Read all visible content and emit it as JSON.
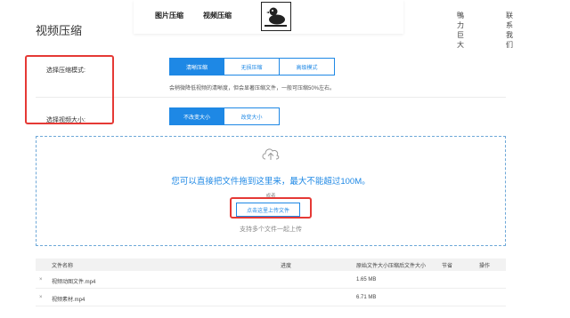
{
  "page": {
    "title": "视频压缩"
  },
  "nav": {
    "image_compress": "图片压缩",
    "video_compress": "视频压缩",
    "link_right_1": "鴨力巨大",
    "link_right_2": "联系我们"
  },
  "settings": {
    "mode": {
      "label": "选择压缩模式:",
      "options": [
        "清晰压缩",
        "无损压缩",
        "高级模式"
      ],
      "selected": "清晰压缩",
      "hint": "会稍微降低视频的清晰度，但会显著压缩文件，一般可压缩50%左右。"
    },
    "size": {
      "label": "选择视频大小:",
      "options": [
        "不改变大小",
        "改变大小"
      ],
      "selected": "不改变大小"
    }
  },
  "dropzone": {
    "message": "您可以直接把文件拖到这里来，最大不能超过100M。",
    "or": "或者",
    "upload_button": "点击这里上传文件",
    "multi": "支持多个文件一起上传"
  },
  "table": {
    "headers": {
      "name": "文件名称",
      "progress": "进度",
      "orig_size": "原始文件大小",
      "comp_size": "压缩后文件大小",
      "saved": "节省",
      "ops": "操作"
    },
    "rows": [
      {
        "remove": "×",
        "name": "视频动图文件.mp4",
        "size": "1.65 MB"
      },
      {
        "remove": "×",
        "name": "视频素材.mp4",
        "size": "6.71 MB"
      }
    ]
  },
  "colors": {
    "accent": "#1e88e5",
    "annotation": "#e53935"
  }
}
